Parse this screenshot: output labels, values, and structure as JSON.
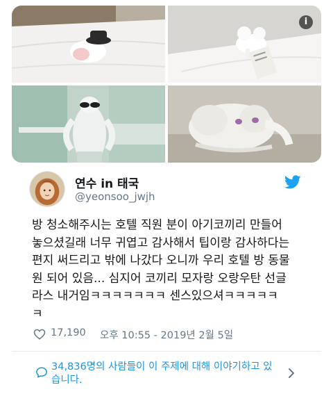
{
  "photos": {
    "items": [
      {
        "icon": "towel-elephant-with-hat-on-bed-photo"
      },
      {
        "icon": "towel-elephant-on-bed-photo"
      },
      {
        "icon": "orangutan-towel-with-sunglasses-photo"
      },
      {
        "icon": "towel-elephant-closeup-photo"
      }
    ],
    "info_icon": "info-icon",
    "info_glyph": "i"
  },
  "author": {
    "display_name": "연수 in 태국",
    "handle": "@yeonsoo_jwjh",
    "avatar_icon": "avatar",
    "platform_icon": "twitter-bird-icon",
    "brand_color": "#1da1f2"
  },
  "tweet": {
    "lines": [
      "방 청소해주시는 호텔 직원 분이 아기코끼리 만들어",
      "놓으셨길래 너무 귀엽고 감사해서 팁이랑 감사하다는",
      "편지 써드리고 밖에 나갔다 오니까 우리 호텔 방 동물",
      "원 되어 있음... 심지어 코끼리 모자랑 오랑우탄 선글",
      "라스 내거임ㅋㅋㅋㅋㅋㅋㅋ 센스있으셔ㅋㅋㅋㅋㅋ",
      "ㅋ"
    ]
  },
  "meta": {
    "like_icon": "heart-icon",
    "likes": "17,190",
    "timestamp": "오후 10:55 - 2019년 2월 5일"
  },
  "conversation": {
    "icon": "speech-bubble-icon",
    "lines": [
      "34,836명의 사람들이 이 주제에 대해 이야기하고 있",
      "습니다."
    ],
    "chevron_icon": "chevron-right-icon",
    "link_color": "#1b95e0"
  }
}
